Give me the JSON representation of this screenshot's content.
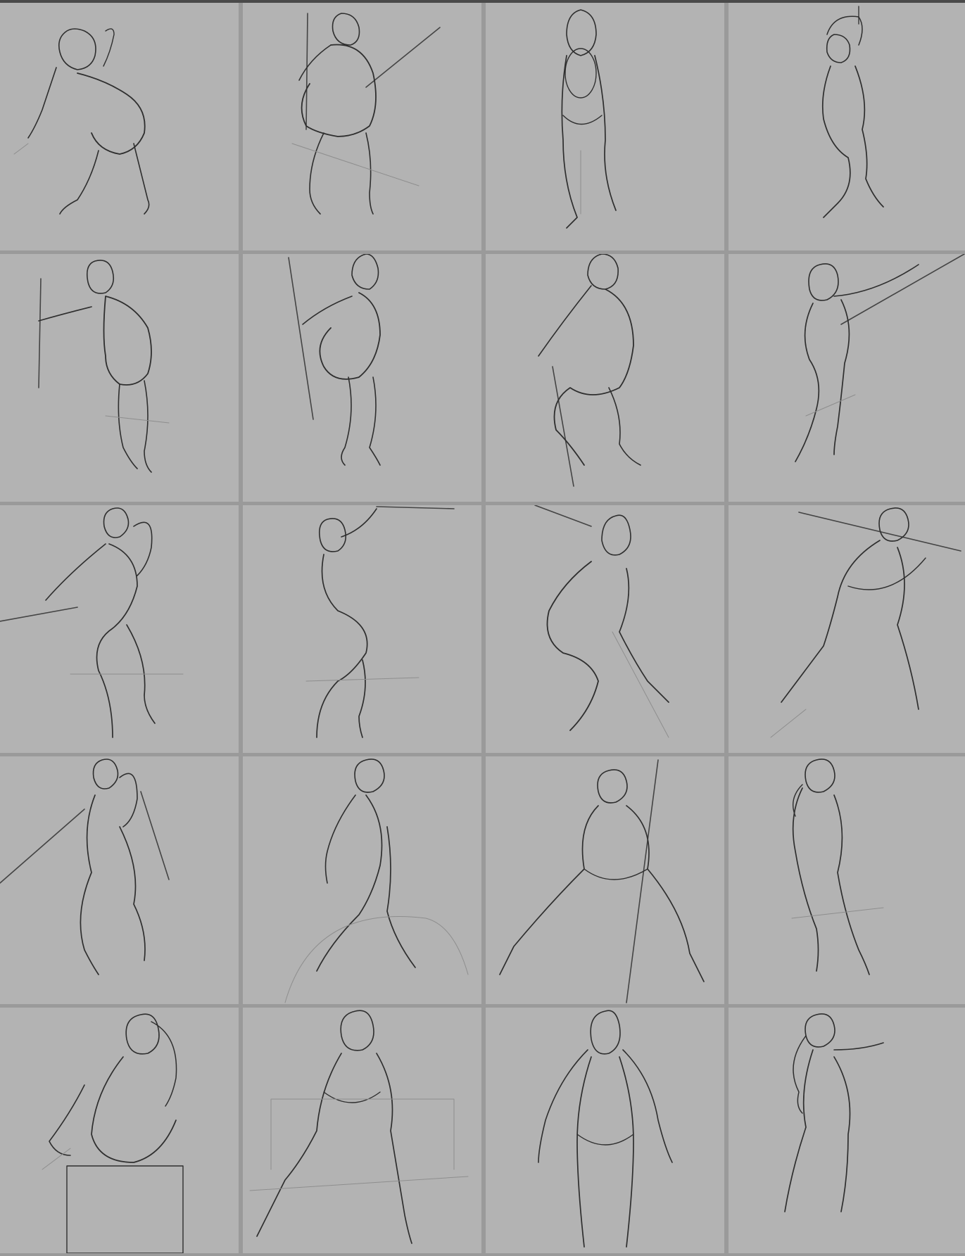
{
  "sheet": {
    "background": "#9a9a9a",
    "panel_color": "#b3b3b3",
    "line_color": "#2e2e2e",
    "columns": 4,
    "rows": 5,
    "panels": [
      {
        "pose": "standing-bent-forward-back-view"
      },
      {
        "pose": "standing-back-view-holding-stick"
      },
      {
        "pose": "standing-back-view"
      },
      {
        "pose": "standing-arms-raised-front-view"
      },
      {
        "pose": "leaning-back-view-holding-stick"
      },
      {
        "pose": "leaning-back-view-holding-stick"
      },
      {
        "pose": "crouching-side-view-holding-stick"
      },
      {
        "pose": "standing-front-view-arm-extended-stick"
      },
      {
        "pose": "standing-front-view-holding-stick"
      },
      {
        "pose": "standing-front-view-arm-raised"
      },
      {
        "pose": "crouching-twisted-pose"
      },
      {
        "pose": "lunging-stick-behind-head"
      },
      {
        "pose": "standing-front-view-holding-stick"
      },
      {
        "pose": "standing-front-view"
      },
      {
        "pose": "wide-stance-holding-stick"
      },
      {
        "pose": "standing-front-view"
      },
      {
        "pose": "seated-on-block"
      },
      {
        "pose": "seated-leaning-back"
      },
      {
        "pose": "standing-back-view"
      },
      {
        "pose": "standing-back-view-arm-extended"
      }
    ]
  }
}
